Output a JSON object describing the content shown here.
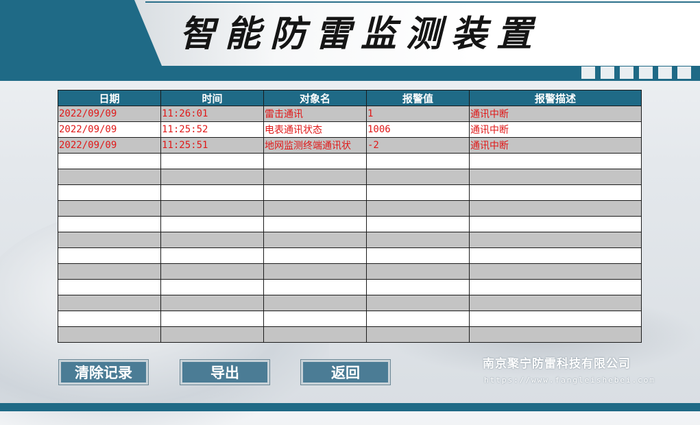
{
  "app": {
    "title": "智能防雷监测装置"
  },
  "table": {
    "headers": [
      "日期",
      "时间",
      "对象名",
      "报警值",
      "报警描述"
    ],
    "rows": [
      [
        "2022/09/09",
        "11:26:01",
        "雷击通讯",
        "1",
        "通讯中断"
      ],
      [
        "2022/09/09",
        "11:25:52",
        "电表通讯状态",
        "1006",
        "通讯中断"
      ],
      [
        "2022/09/09",
        "11:25:51",
        "地网监测终端通讯状",
        "-2",
        "通讯中断"
      ],
      [
        "",
        "",
        "",
        "",
        ""
      ],
      [
        "",
        "",
        "",
        "",
        ""
      ],
      [
        "",
        "",
        "",
        "",
        ""
      ],
      [
        "",
        "",
        "",
        "",
        ""
      ],
      [
        "",
        "",
        "",
        "",
        ""
      ],
      [
        "",
        "",
        "",
        "",
        ""
      ],
      [
        "",
        "",
        "",
        "",
        ""
      ],
      [
        "",
        "",
        "",
        "",
        ""
      ],
      [
        "",
        "",
        "",
        "",
        ""
      ],
      [
        "",
        "",
        "",
        "",
        ""
      ],
      [
        "",
        "",
        "",
        "",
        ""
      ],
      [
        "",
        "",
        "",
        "",
        ""
      ]
    ]
  },
  "buttons": {
    "clear": "清除记录",
    "export": "导出",
    "back": "返回"
  },
  "company": {
    "name": "南京聚宁防雷科技有限公司",
    "url": "https://www.fangleishebei.com"
  },
  "colors": {
    "accent": "#1f6a86",
    "alarm_text": "#e01818",
    "row_alt": "#c4c4c4"
  }
}
